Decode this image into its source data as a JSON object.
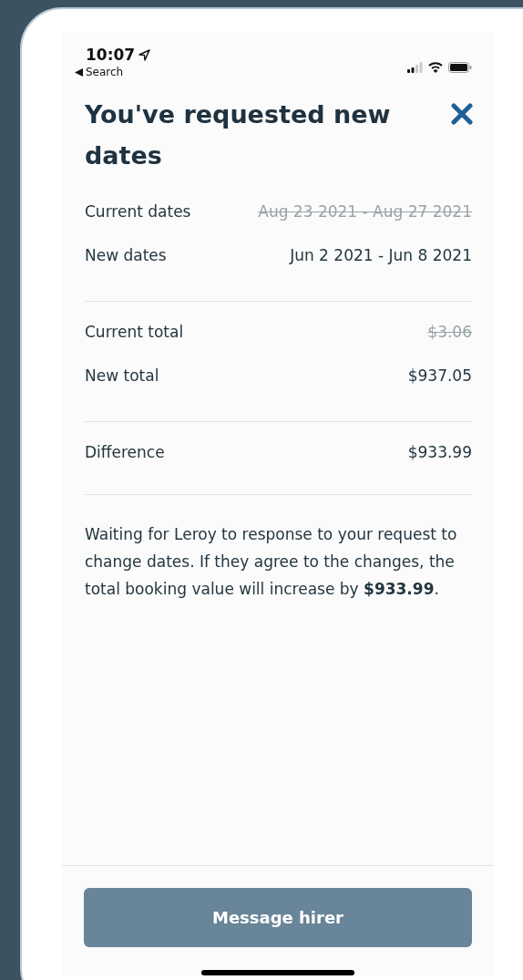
{
  "status_bar": {
    "time": "10:07",
    "back_label": "Search"
  },
  "title": "You've requested new dates",
  "sections": [
    {
      "rows": [
        {
          "label": "Current dates",
          "value": "Aug 23 2021 - Aug 27 2021",
          "struck": true
        },
        {
          "label": "New dates",
          "value": "Jun 2 2021 - Jun 8 2021",
          "struck": false
        }
      ]
    },
    {
      "rows": [
        {
          "label": "Current total",
          "value": "$3.06",
          "struck": true
        },
        {
          "label": "New total",
          "value": "$937.05",
          "struck": false
        }
      ]
    },
    {
      "rows": [
        {
          "label": "Difference",
          "value": "$933.99",
          "struck": false
        }
      ]
    }
  ],
  "message": "Waiting for Leroy to response to your request to change dates. If they agree to the changes, the total booking value will increase by **$933.99**.",
  "button": "Message hirer"
}
